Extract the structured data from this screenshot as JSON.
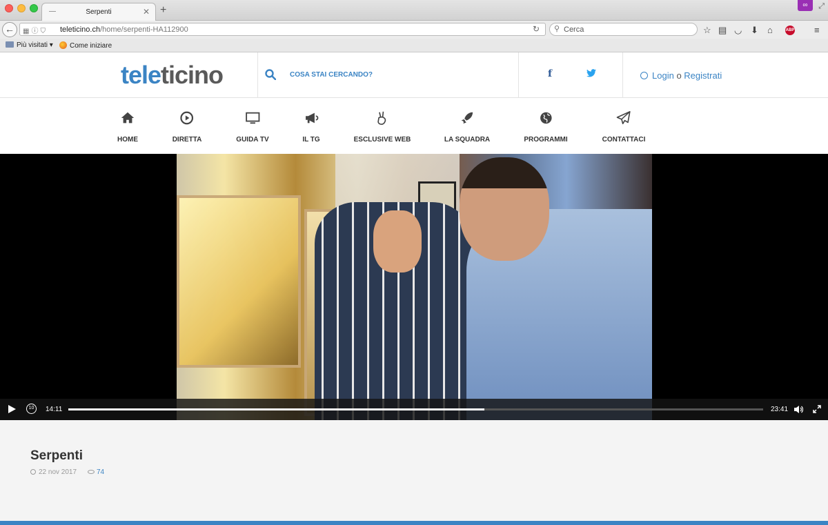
{
  "browser": {
    "tab_title": "Serpenti",
    "url_host": "teleticino.ch",
    "url_path": "/home/serpenti-HA112900",
    "search_placeholder": "Cerca",
    "bookmarks": [
      {
        "label": "Più visitati"
      },
      {
        "label": "Come iniziare"
      }
    ],
    "adblock_badge": "ABP"
  },
  "site": {
    "logo_part1": "tele",
    "logo_part2": "ticino",
    "search_label": "COSA STAI CERCANDO?",
    "login_label": "Login",
    "or_label": "o",
    "register_label": "Registrati",
    "brand_color": "#3b84c4"
  },
  "nav": [
    {
      "label": "HOME",
      "icon": "home-icon"
    },
    {
      "label": "DIRETTA",
      "icon": "play-circle-icon"
    },
    {
      "label": "GUIDA TV",
      "icon": "monitor-icon"
    },
    {
      "label": "IL TG",
      "icon": "megaphone-icon"
    },
    {
      "label": "ESCLUSIVE WEB",
      "icon": "hand-peace-icon"
    },
    {
      "label": "LA SQUADRA",
      "icon": "rocket-icon"
    },
    {
      "label": "PROGRAMMI",
      "icon": "globe-icon"
    },
    {
      "label": "CONTATTACI",
      "icon": "paper-plane-icon"
    }
  ],
  "player": {
    "current_time": "14:11",
    "duration": "23:41",
    "rewind_label": "10",
    "progress_fraction": 0.599
  },
  "article": {
    "title": "Serpenti",
    "date": "22 nov 2017",
    "views": "74"
  }
}
